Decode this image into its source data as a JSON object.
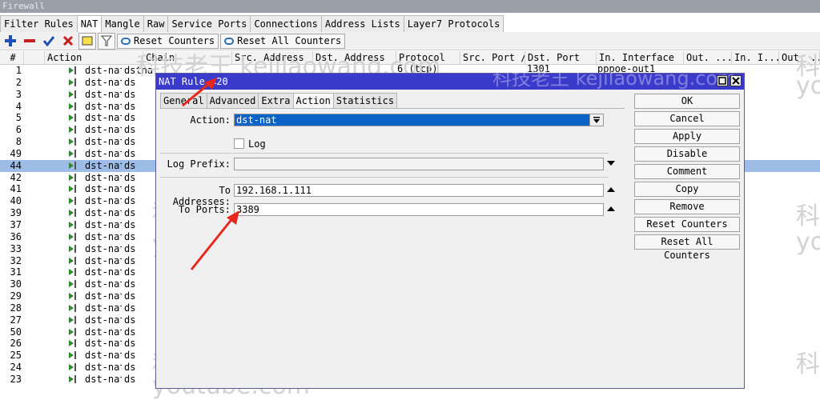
{
  "window": {
    "title": "Firewall"
  },
  "tabs": [
    "Filter Rules",
    "NAT",
    "Mangle",
    "Raw",
    "Service Ports",
    "Connections",
    "Address Lists",
    "Layer7 Protocols"
  ],
  "toolbar": {
    "reset_counters": "Reset Counters",
    "reset_all_counters": "Reset All Counters"
  },
  "columns": [
    "#",
    "Action",
    "Chain",
    "Src. Address",
    "Dst. Address",
    "Protocol",
    "Src. Port /",
    "Dst. Port",
    "In. Interface",
    "Out. ...",
    "In. I...",
    "Out. ..."
  ],
  "first_row": {
    "chain": "dstnat",
    "protocol": "6 (tcp)",
    "dst_port": "1301",
    "in_interface": "pppoe-out1"
  },
  "rows": [
    {
      "num": "1",
      "action": "dst-nat",
      "chain": "ds"
    },
    {
      "num": "2",
      "action": "dst-nat",
      "chain": "ds"
    },
    {
      "num": "3",
      "action": "dst-nat",
      "chain": "ds"
    },
    {
      "num": "4",
      "action": "dst-nat",
      "chain": "ds"
    },
    {
      "num": "5",
      "action": "dst-nat",
      "chain": "ds"
    },
    {
      "num": "6",
      "action": "dst-nat",
      "chain": "ds"
    },
    {
      "num": "8",
      "action": "dst-nat",
      "chain": "ds"
    },
    {
      "num": "49",
      "action": "dst-nat",
      "chain": "ds"
    },
    {
      "num": "44",
      "action": "dst-nat",
      "chain": "ds",
      "selected": true
    },
    {
      "num": "42",
      "action": "dst-nat",
      "chain": "ds"
    },
    {
      "num": "41",
      "action": "dst-nat",
      "chain": "ds"
    },
    {
      "num": "40",
      "action": "dst-nat",
      "chain": "ds"
    },
    {
      "num": "39",
      "action": "dst-nat",
      "chain": "ds"
    },
    {
      "num": "37",
      "action": "dst-nat",
      "chain": "ds"
    },
    {
      "num": "36",
      "action": "dst-nat",
      "chain": "ds"
    },
    {
      "num": "33",
      "action": "dst-nat",
      "chain": "ds"
    },
    {
      "num": "32",
      "action": "dst-nat",
      "chain": "ds"
    },
    {
      "num": "31",
      "action": "dst-nat",
      "chain": "ds"
    },
    {
      "num": "30",
      "action": "dst-nat",
      "chain": "ds"
    },
    {
      "num": "29",
      "action": "dst-nat",
      "chain": "ds"
    },
    {
      "num": "28",
      "action": "dst-nat",
      "chain": "ds"
    },
    {
      "num": "27",
      "action": "dst-nat",
      "chain": "ds"
    },
    {
      "num": "50",
      "action": "dst-nat",
      "chain": "ds"
    },
    {
      "num": "26",
      "action": "dst-nat",
      "chain": "ds"
    },
    {
      "num": "25",
      "action": "dst-nat",
      "chain": "ds"
    },
    {
      "num": "24",
      "action": "dst-nat",
      "chain": "ds"
    },
    {
      "num": "23",
      "action": "dst-nat",
      "chain": "ds"
    }
  ],
  "dialog": {
    "title": "NAT Rule <20",
    "tabs": [
      "General",
      "Advanced",
      "Extra",
      "Action",
      "Statistics"
    ],
    "action_label": "Action:",
    "action_value": "dst-nat",
    "log_label": "Log",
    "log_prefix_label": "Log Prefix:",
    "to_addresses_label": "To Addresses:",
    "to_addresses_value": "192.168.1.111",
    "to_ports_label": "To Ports:",
    "to_ports_value": "3389",
    "buttons": [
      "OK",
      "Cancel",
      "Apply",
      "Disable",
      "Comment",
      "Copy",
      "Remove",
      "Reset Counters",
      "Reset All Counters"
    ]
  },
  "watermark": {
    "site": "科技老王 kejilaowang.com",
    "youtube": "youtube.com/@科技老王",
    "youtube_short": "youtube.com",
    "name": "科技老王",
    "name_short": "科技",
    "yo": "yo"
  },
  "colors": {
    "dialog_title": "#3a3acb",
    "selection": "#9dbde6",
    "field_selected": "#0b63c8",
    "arrow": "#e8281c"
  }
}
